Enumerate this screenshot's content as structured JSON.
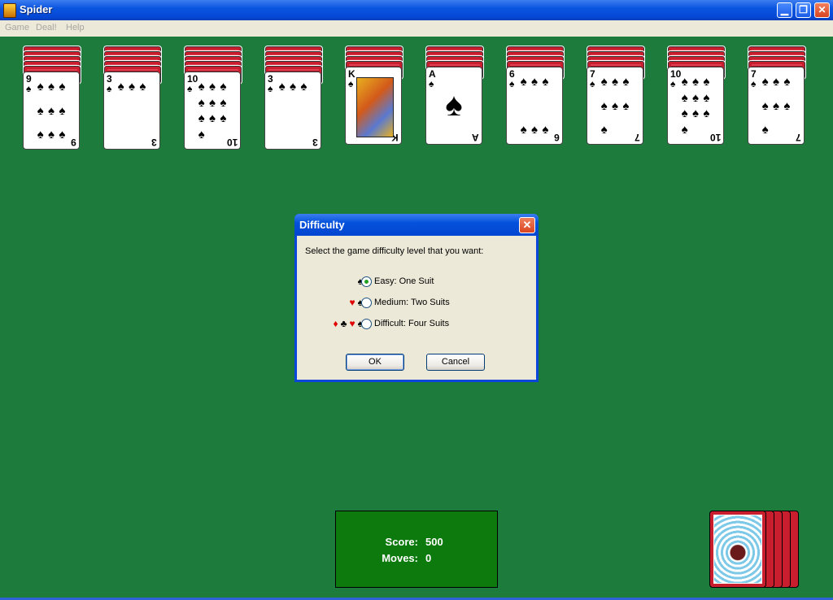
{
  "window": {
    "title": "Spider",
    "min_glyph": "▁",
    "max_glyph": "❐",
    "close_glyph": "✕"
  },
  "menu": [
    "Game",
    "Deal!",
    "Help"
  ],
  "tableau": [
    {
      "backs": 5,
      "rank": "9",
      "suit": "♠"
    },
    {
      "backs": 5,
      "rank": "3",
      "suit": "♠"
    },
    {
      "backs": 5,
      "rank": "10",
      "suit": "♠"
    },
    {
      "backs": 5,
      "rank": "3",
      "suit": "♠"
    },
    {
      "backs": 4,
      "rank": "K",
      "suit": "♠"
    },
    {
      "backs": 4,
      "rank": "A",
      "suit": "♠"
    },
    {
      "backs": 4,
      "rank": "6",
      "suit": "♠"
    },
    {
      "backs": 4,
      "rank": "7",
      "suit": "♠"
    },
    {
      "backs": 4,
      "rank": "10",
      "suit": "♠"
    },
    {
      "backs": 4,
      "rank": "7",
      "suit": "♠"
    }
  ],
  "dialog": {
    "title": "Difficulty",
    "close_glyph": "✕",
    "prompt": "Select the game difficulty level that you want:",
    "options": [
      {
        "suits": "♠",
        "label": "Easy: One Suit",
        "selected": true
      },
      {
        "suits": "♥♠",
        "label": "Medium: Two Suits",
        "selected": false
      },
      {
        "suits": "♦♣♥♠",
        "label": "Difficult: Four Suits",
        "selected": false
      }
    ],
    "ok_label": "OK",
    "cancel_label": "Cancel"
  },
  "score": {
    "score_label": "Score:",
    "score_value": "500",
    "moves_label": "Moves:",
    "moves_value": "0"
  },
  "stock": {
    "count": 5
  },
  "colors": {
    "felt": "#1d7b3b",
    "card_back": "#c81e2e",
    "score_box": "#0c7a0c",
    "red_suit": "#e00000"
  }
}
